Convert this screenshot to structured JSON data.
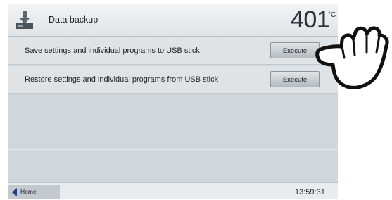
{
  "header": {
    "title": "Data backup",
    "icon": "usb-backup-icon",
    "temperature": "401",
    "temperature_unit": "°C"
  },
  "actions": [
    {
      "label": "Save settings and individual programs to USB stick",
      "button": "Execute"
    },
    {
      "label": "Restore settings and individual programs from USB stick",
      "button": "Execute"
    }
  ],
  "footer": {
    "home_label": "Home",
    "time": "13:59:31"
  },
  "colors": {
    "screen_bg": "#d4d9dd",
    "home_arrow": "#1e3f85"
  }
}
